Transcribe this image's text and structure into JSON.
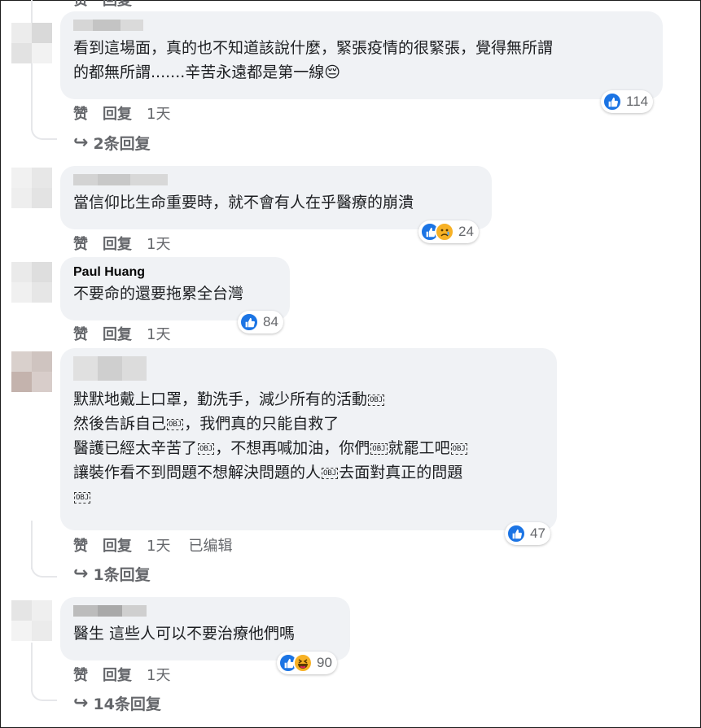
{
  "actions": {
    "like": "赞",
    "reply": "回复"
  },
  "comments": [
    {
      "text": "看到這場面，真的也不知道該說什麼，緊張疫情的很緊張，覺得無所謂\n的都無所謂.......辛苦永遠都是第一線",
      "emoji": "😔",
      "reaction_count": "114",
      "time": "1天",
      "replies": "2条回复"
    },
    {
      "text": "當信仰比生命重要時，就不會有人在乎醫療的崩潰",
      "reaction_count": "24",
      "time": "1天"
    },
    {
      "author": "Paul Huang",
      "text": "不要命的還要拖累全台灣",
      "reaction_count": "84",
      "time": "1天"
    },
    {
      "lines": [
        "默默地戴上口罩，勤洗手，減少所有的活動",
        "然後告訴自己",
        "，我們真的只能自救了",
        "醫護已經太辛苦了",
        "，不想再喊加油，你們",
        "就罷工吧",
        "讓裝作看不到問題不想解決問題的人",
        "去面對真正的問題"
      ],
      "obj_label": "OBJ",
      "reaction_count": "47",
      "time": "1天",
      "edited": "已编辑",
      "replies": "1条回复"
    },
    {
      "text": "醫生 這些人可以不要治療他們嗎",
      "reaction_count": "90",
      "time": "1天",
      "replies": "14条回复"
    }
  ],
  "colors": {
    "like_blue": "#1b74e4",
    "bubble_bg": "#f0f2f5",
    "meta_gray": "#65676b"
  }
}
